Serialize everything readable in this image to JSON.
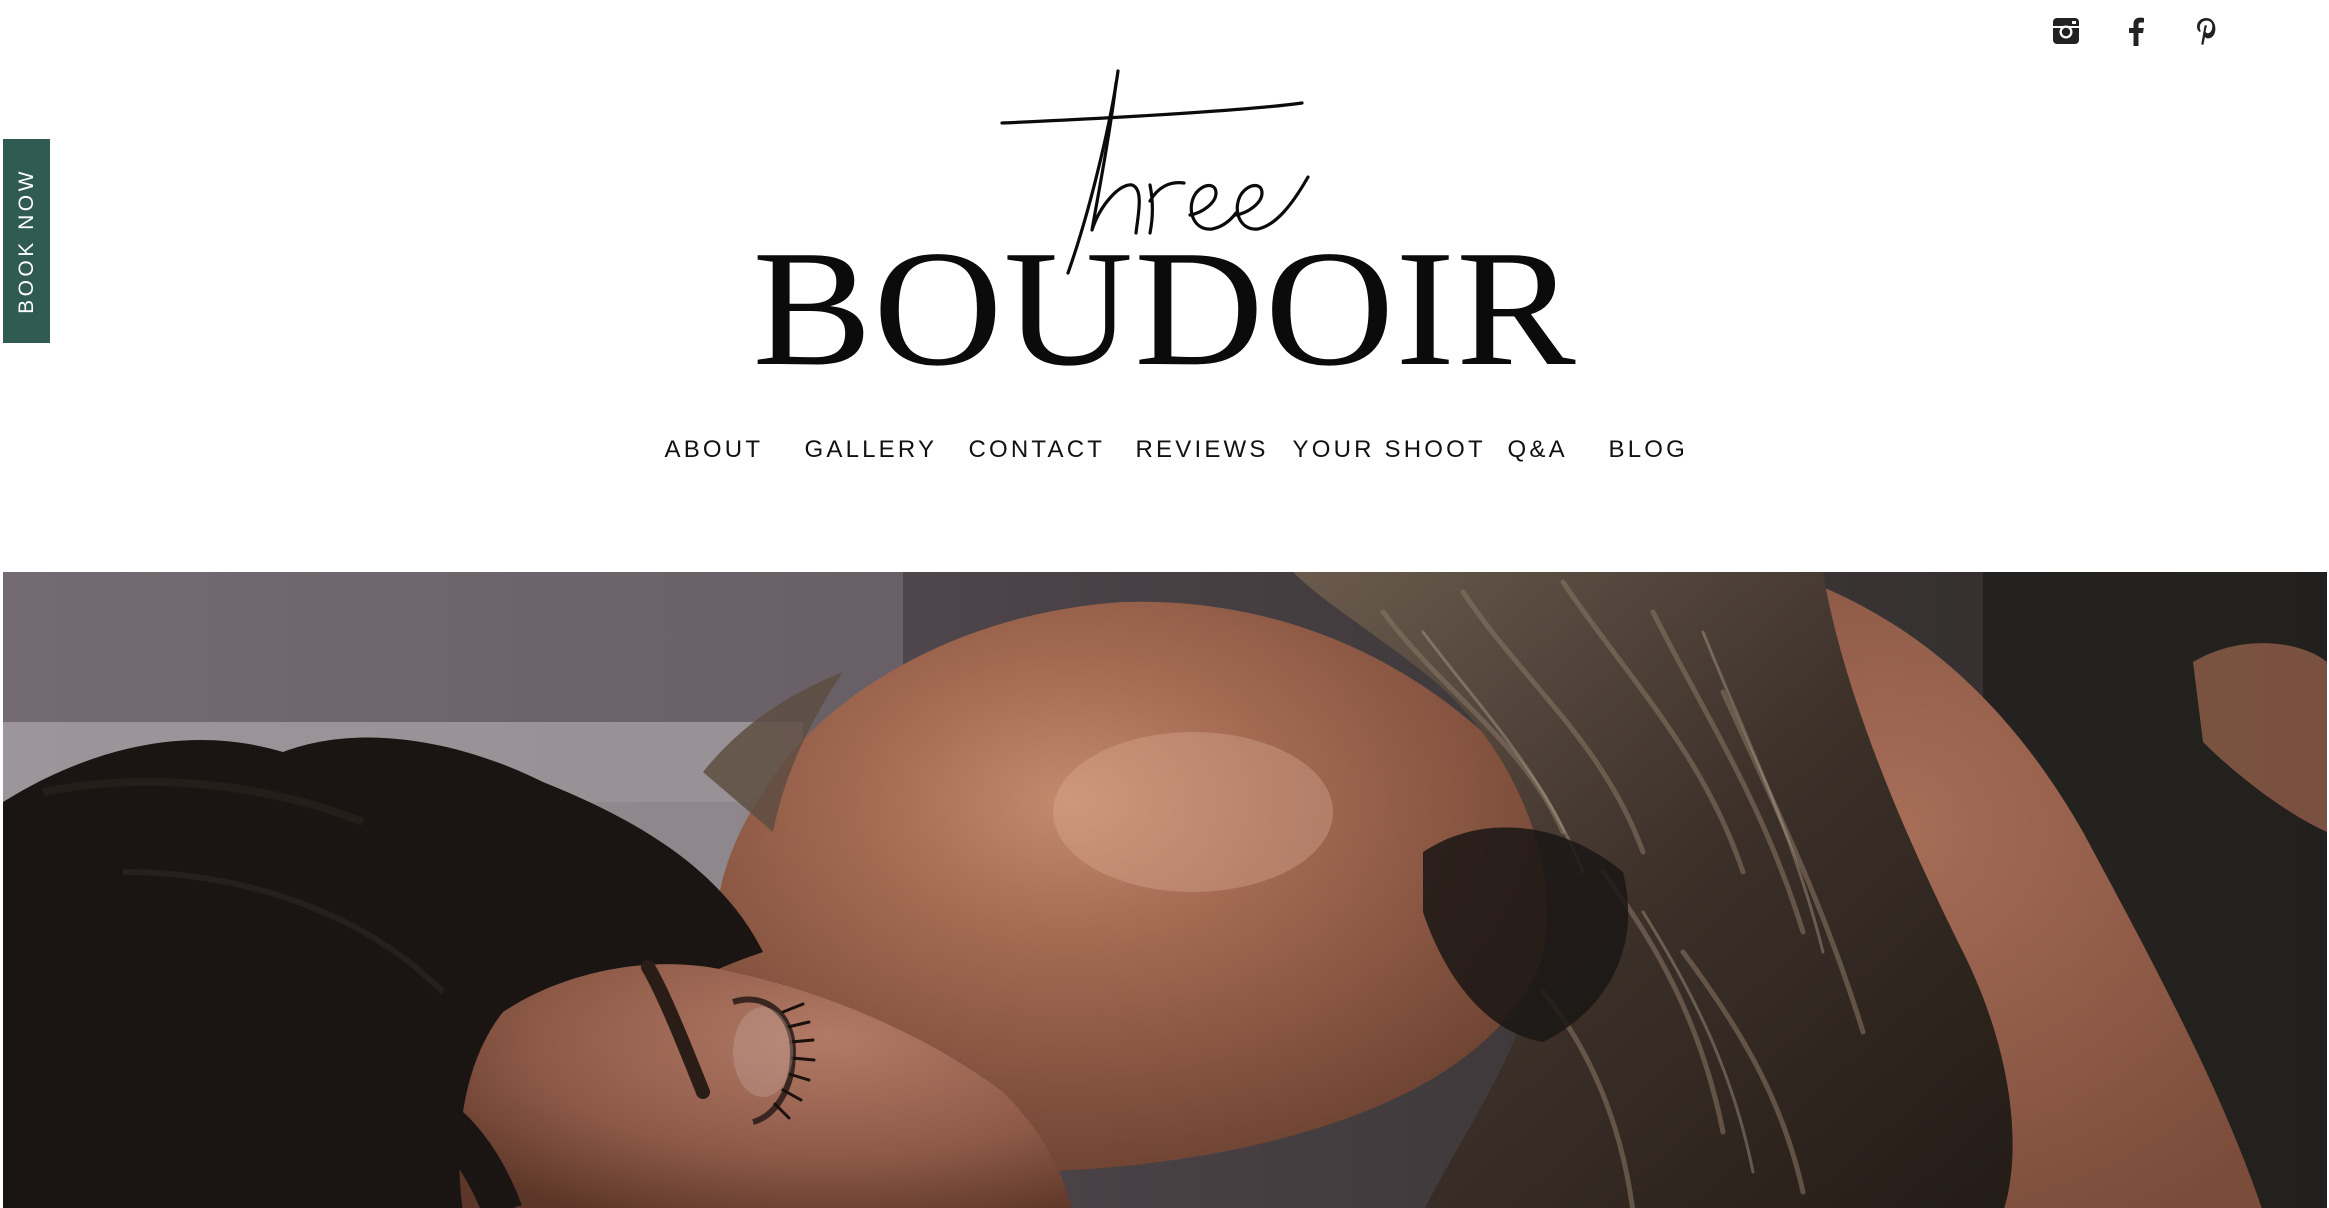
{
  "brand": {
    "script_word": "three",
    "wordmark": "BOUDOIR"
  },
  "book_now": {
    "label": "BOOK NOW",
    "color": "#2f5b52"
  },
  "social": [
    {
      "icon": "instagram-icon"
    },
    {
      "icon": "facebook-icon"
    },
    {
      "icon": "pinterest-icon"
    }
  ],
  "nav": {
    "items": [
      {
        "label": "ABOUT"
      },
      {
        "label": "GALLERY"
      },
      {
        "label": "CONTACT"
      },
      {
        "label": "REVIEWS"
      },
      {
        "label": "YOUR SHOOT"
      },
      {
        "label": "Q&A"
      },
      {
        "label": "BLOG"
      }
    ]
  }
}
